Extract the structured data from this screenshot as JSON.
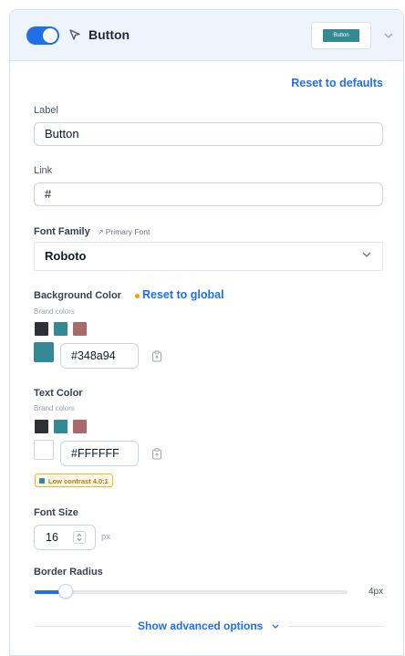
{
  "header": {
    "title": "Button",
    "toggle_on": true,
    "preview_label": "Button"
  },
  "actions": {
    "reset_defaults": "Reset to defaults",
    "reset_global": "Reset to global",
    "show_advanced": "Show advanced options"
  },
  "fields": {
    "label": {
      "label": "Label",
      "value": "Button"
    },
    "link": {
      "label": "Link",
      "value": "#"
    },
    "font_family": {
      "label": "Font Family",
      "hint": "Primary Font",
      "value": "Roboto"
    },
    "background_color": {
      "label": "Background Color",
      "brand_label": "Brand colors",
      "brand_colors": [
        "#2f3033",
        "#348a94",
        "#a86b6b"
      ],
      "value": "#348a94",
      "preview_color": "#348a94"
    },
    "text_color": {
      "label": "Text Color",
      "brand_label": "Brand colors",
      "brand_colors": [
        "#2f3033",
        "#348a94",
        "#a86b6b"
      ],
      "value": "#FFFFFF",
      "preview_color": "#ffffff",
      "contrast_badge": "Low contrast 4.0:1"
    },
    "font_size": {
      "label": "Font Size",
      "value": "16",
      "unit": "px"
    },
    "border_radius": {
      "label": "Border Radius",
      "value": "4px",
      "fraction": 0.1
    }
  },
  "colors": {
    "accent": "#1f6feb",
    "warning": "#f59e0b"
  },
  "icons": {
    "cursor": "cursor-arrow-icon",
    "chevron": "chevron-down-icon",
    "copy": "copy-clipboard-icon",
    "hint": "arrow-up-right-icon"
  }
}
